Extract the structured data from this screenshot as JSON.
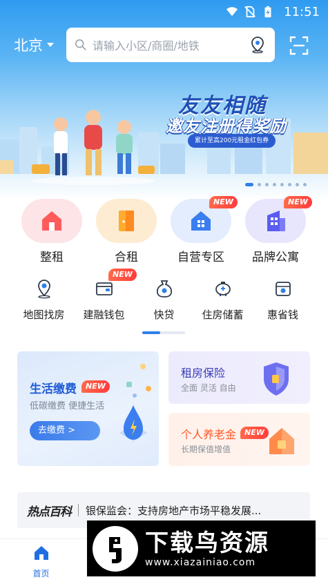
{
  "status_bar": {
    "time": "11:51"
  },
  "header": {
    "city": "北京",
    "search_placeholder": "请输入小区/商圈/地铁"
  },
  "banner": {
    "slogan_main": "友友相随",
    "slogan_sub": "邀友注册得奖励",
    "slogan_pill": "累计至高200元租金红包券",
    "slides_count": 8,
    "active_slide": 1
  },
  "big_grid": [
    {
      "label": "整租",
      "icon": "house-icon",
      "color": "#ff5b5b",
      "new": false
    },
    {
      "label": "合租",
      "icon": "door-icon",
      "color": "#ffab2e",
      "new": false
    },
    {
      "label": "自营专区",
      "icon": "home-grid-icon",
      "color": "#3a7ef0",
      "new": true
    },
    {
      "label": "品牌公寓",
      "icon": "building-icon",
      "color": "#5b5cf0",
      "new": true
    }
  ],
  "small_grid": [
    {
      "label": "地图找房",
      "icon": "map-pin-icon",
      "new": false
    },
    {
      "label": "建融钱包",
      "icon": "wallet-icon",
      "new": true
    },
    {
      "label": "快贷",
      "icon": "money-bag-icon",
      "new": false
    },
    {
      "label": "住房储蓄",
      "icon": "piggy-bank-icon",
      "new": false
    },
    {
      "label": "惠省钱",
      "icon": "coupon-icon",
      "new": false
    }
  ],
  "new_tag": "NEW",
  "cards": {
    "left": {
      "title": "生活缴费",
      "subtitle": "低碳缴费 便捷生活",
      "button": "去缴费 >"
    },
    "right_top": {
      "title": "租房保险",
      "subtitle": "全面 灵活 自由"
    },
    "right_bottom": {
      "title": "个人养老金",
      "subtitle": "长期保值增值"
    }
  },
  "news": {
    "logo": "热点百科",
    "text": "银保监会：支持房地产市场平稳发展..."
  },
  "tabs": [
    {
      "label": "首页",
      "active": true
    }
  ],
  "watermark": {
    "title": "下载鸟资源",
    "url": "www.xiazainiao.com"
  }
}
